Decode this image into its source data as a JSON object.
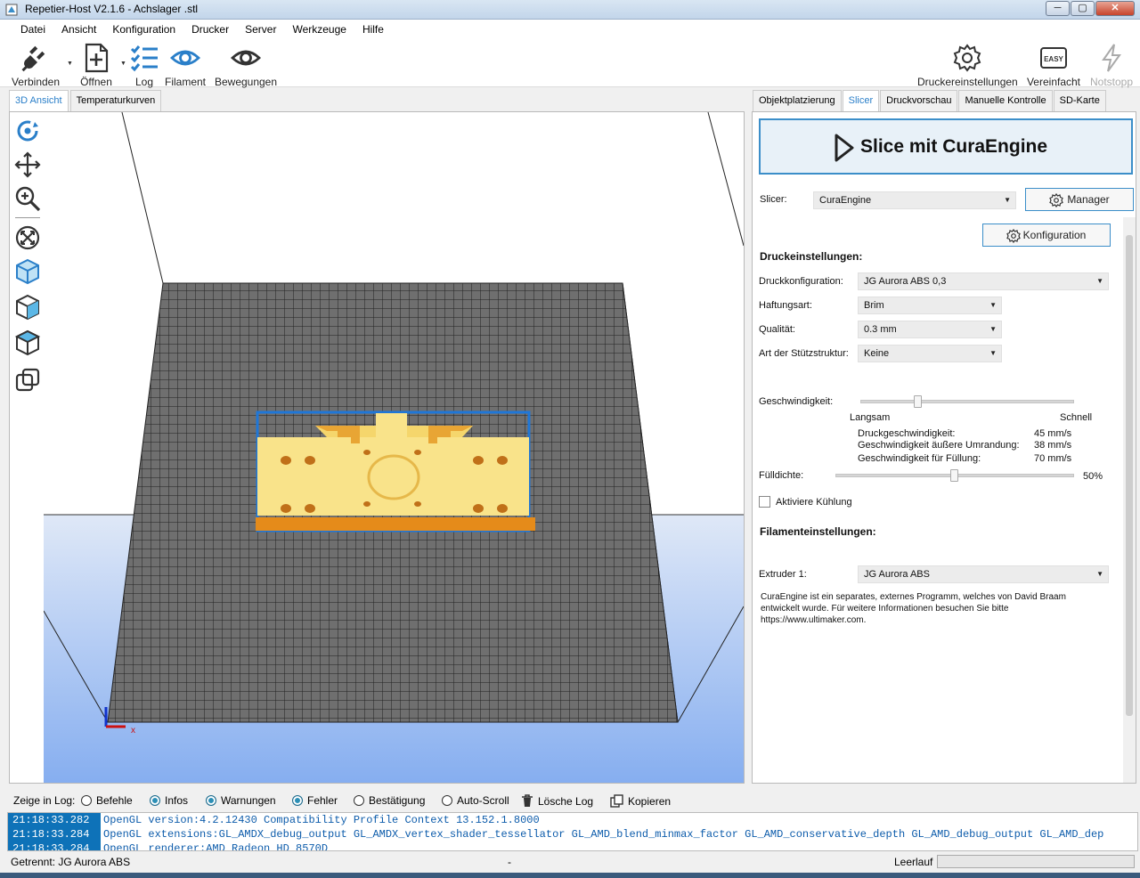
{
  "window": {
    "title": "Repetier-Host V2.1.6 - Achslager .stl",
    "buttons": {
      "minimize": "─",
      "maximize": "▢",
      "close": "✕"
    }
  },
  "menu": [
    "Datei",
    "Ansicht",
    "Konfiguration",
    "Drucker",
    "Server",
    "Werkzeuge",
    "Hilfe"
  ],
  "toolbar": {
    "connect": "Verbinden",
    "open": "Öffnen",
    "log": "Log",
    "filament": "Filament",
    "moves": "Bewegungen",
    "printer_settings": "Druckereinstellungen",
    "easy_mode": "Vereinfacht",
    "easy_badge": "EASY",
    "emergency": "Notstopp"
  },
  "left_tabs": [
    "3D Ansicht",
    "Temperaturkurven"
  ],
  "right_tabs": [
    "Objektplatzierung",
    "Slicer",
    "Druckvorschau",
    "Manuelle Kontrolle",
    "SD-Karte"
  ],
  "slicer": {
    "slice_button": "Slice mit CuraEngine",
    "slicer_label": "Slicer:",
    "slicer_value": "CuraEngine",
    "manager_button": "Manager",
    "config_button": "Konfiguration",
    "print_settings_title": "Druckeinstellungen:",
    "print_config_label": "Druckkonfiguration:",
    "print_config_value": "JG Aurora ABS 0,3",
    "adhesion_label": "Haftungsart:",
    "adhesion_value": "Brim",
    "quality_label": "Qualität:",
    "quality_value": "0.3 mm",
    "support_label": "Art der Stützstruktur:",
    "support_value": "Keine",
    "speed_label": "Geschwindigkeit:",
    "speed_slow": "Langsam",
    "speed_fast": "Schnell",
    "speed_level": 0.27,
    "print_speed_label": "Druckgeschwindigkeit:",
    "print_speed_value": "45 mm/s",
    "outer_speed_label": "Geschwindigkeit äußere Umrandung:",
    "outer_speed_value": "38 mm/s",
    "infill_speed_label": "Geschwindigkeit für Füllung:",
    "infill_speed_value": "70 mm/s",
    "infill_label": "Fülldichte:",
    "infill_value": "50%",
    "infill_level": 0.5,
    "cooling_label": "Aktiviere Kühlung",
    "filament_title": "Filamenteinstellungen:",
    "extruder_label": "Extruder 1:",
    "extruder_value": "JG Aurora ABS",
    "info_line1": "CuraEngine ist ein separates, externes Programm, welches von David Braam",
    "info_line2": "entwickelt wurde. Für weitere Informationen besuchen Sie bitte",
    "info_line3": "https://www.ultimaker.com."
  },
  "log": {
    "show_label": "Zeige in Log:",
    "options": [
      {
        "label": "Befehle",
        "checked": false
      },
      {
        "label": "Infos",
        "checked": true
      },
      {
        "label": "Warnungen",
        "checked": true
      },
      {
        "label": "Fehler",
        "checked": true
      },
      {
        "label": "Bestätigung",
        "checked": false
      },
      {
        "label": "Auto-Scroll",
        "checked": false
      }
    ],
    "clear": "Lösche Log",
    "copy": "Kopieren",
    "rows": [
      {
        "time": "21:18:33.282",
        "msg": "OpenGL version:4.2.12430 Compatibility Profile Context 13.152.1.8000"
      },
      {
        "time": "21:18:33.284",
        "msg": "OpenGL extensions:GL_AMDX_debug_output GL_AMDX_vertex_shader_tessellator GL_AMD_blend_minmax_factor GL_AMD_conservative_depth GL_AMD_debug_output GL_AMD_dep"
      },
      {
        "time": "21:18:33.284",
        "msg": "OpenGL renderer:AMD Radeon HD 8570D"
      }
    ]
  },
  "status": {
    "left": "Getrennt: JG Aurora ABS",
    "mid": "-",
    "right": "Leerlauf"
  },
  "colors": {
    "accent": "#2a7fc9",
    "model": "#f9e38a",
    "bed": "#6f6f6f"
  }
}
